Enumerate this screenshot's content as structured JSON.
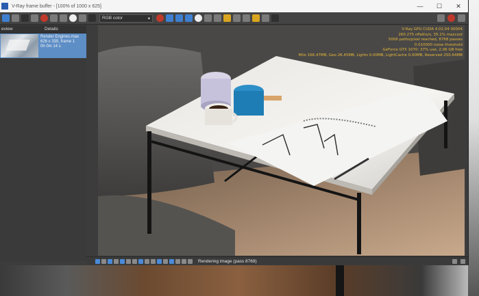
{
  "window": {
    "title": "V-Ray frame buffer - [100% of 1000 x 625]",
    "minimize": "—",
    "maximize": "☐",
    "close": "✕"
  },
  "toolbar": {
    "channel": "RGB color"
  },
  "panel": {
    "tab_history": "eview",
    "tab_details": "Details",
    "history_item": {
      "name": "Render Engines.max",
      "size": "626 x 335, frame 1",
      "time": "0h 0m 14 s"
    }
  },
  "render_info": [
    "V-Ray GPU CUDA 4.02.04 00004",
    "260.275 nPaths/s, 35.1% maxcost",
    "5006 paths/pixel reached, 8768 passes",
    "0.010000 noise threshold",
    "GeForce GTX 1070: 37% use, 2.06 GB free",
    "Mtls 166.47MB, Geo 26.45MB, Lights 0.00MB, LightCache 0.00MB, Reserved 250.64MB"
  ],
  "status": {
    "text": "Rendering image (pass 8769)"
  },
  "colors": {
    "accent": "#3f7fd0",
    "info_text": "#e7b83a",
    "selected_item": "#5d8ec6"
  }
}
